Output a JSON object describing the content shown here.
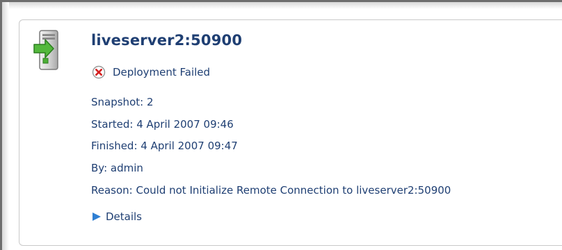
{
  "panel": {
    "title": "liveserver2:50900",
    "status": "Deployment Failed",
    "colors": {
      "text": "#1f3f73",
      "error": "#d42020",
      "arrow": "#2f7fd3",
      "server_green": "#4caf36"
    },
    "icons": {
      "server": "server-deploy-icon",
      "status": "error-circle-icon",
      "details": "expand-arrow-icon"
    },
    "fields": [
      "Snapshot: 2",
      "Started: 4 April 2007 09:46",
      "Finished: 4 April 2007 09:47",
      "By: admin",
      "Reason: Could not Initialize Remote Connection to liveserver2:50900"
    ],
    "details_label": "Details"
  }
}
